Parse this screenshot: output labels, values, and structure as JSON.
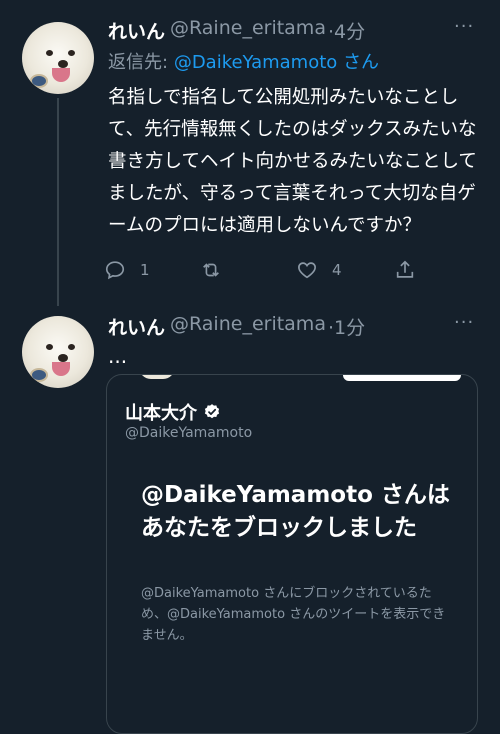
{
  "tweets": [
    {
      "display_name": "れいん",
      "handle": "@Raine_eritama",
      "time": "·4分",
      "more": "···",
      "reply_prefix": "返信先:",
      "reply_mention": "@DaikeYamamoto",
      "reply_suffix": "さん",
      "text": "名指しで指名して公開処刑みたいなことして、先行情報無くしたのはダックスみたいな書き方してヘイト向かせるみたいなことしてましたが、守るって言葉それって大切な自ゲームのプロには適用しないんですか？",
      "reply_count": "1",
      "like_count": "4",
      "icons": [
        "reply-icon",
        "retweet-icon",
        "like-icon",
        "share-icon"
      ]
    },
    {
      "display_name": "れいん",
      "handle": "@Raine_eritama",
      "time": "·1分",
      "more": "···",
      "text": "..."
    }
  ],
  "quoted_card": {
    "name": "山本大介",
    "handle": "@DaikeYamamoto",
    "verified_icon": "verified-badge-icon",
    "blocked_title": "@DaikeYamamoto さんはあなたをブロックしました",
    "blocked_desc": "@DaikeYamamoto さんにブロックされているため、@DaikeYamamoto さんのツイートを表示できません。"
  },
  "colors": {
    "background": "#15202b",
    "text": "#ffffff",
    "secondary": "#8b98a5",
    "accent": "#1d9bf0",
    "border": "#38444d"
  }
}
